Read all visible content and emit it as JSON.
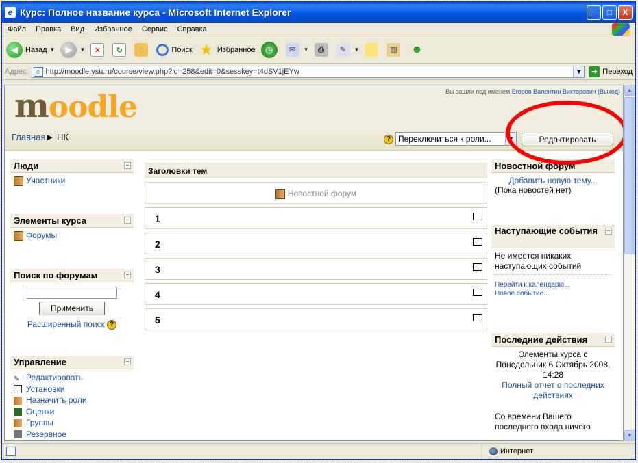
{
  "window": {
    "title": "Курс: Полное название курса - Microsoft Internet Explorer",
    "min": "_",
    "max": "□",
    "close": "X"
  },
  "menu": [
    "Файл",
    "Правка",
    "Вид",
    "Избранное",
    "Сервис",
    "Справка"
  ],
  "toolbar": {
    "back": "Назад",
    "search": "Поиск",
    "favorites": "Избранное"
  },
  "address": {
    "label": "Адрес:",
    "url": "http://moodle.ysu.ru/course/view.php?id=258&edit=0&sesskey=t4dSV1jEYw",
    "go": "Переход"
  },
  "status": {
    "zone": "Интернет"
  },
  "moodle": {
    "logo_m": "m",
    "logo_rest": "oodle",
    "login_text": "Вы зашли под именем",
    "login_user": "Егоров Валентин Викторович",
    "login_exit": "(Выход)",
    "breadcrumb_home": "Главная",
    "breadcrumb_sep": "►",
    "breadcrumb_course": "НК",
    "help": "?",
    "role_switch": "Переключиться к роли...",
    "edit_button": "Редактировать"
  },
  "left": {
    "people": {
      "title": "Люди",
      "items": [
        "Участники"
      ]
    },
    "activities": {
      "title": "Элементы курса",
      "items": [
        "Форумы"
      ]
    },
    "search": {
      "title": "Поиск по форумам",
      "input_value": "",
      "button": "Применить",
      "advanced": "Расширенный поиск"
    },
    "admin": {
      "title": "Управление",
      "items": [
        "Редактировать",
        "Установки",
        "Назначить роли",
        "Оценки",
        "Группы",
        "Резервное"
      ]
    }
  },
  "center": {
    "header": "Заголовки тем",
    "news": "Новостной форум",
    "topics": [
      "1",
      "2",
      "3",
      "4",
      "5"
    ]
  },
  "right": {
    "news": {
      "title": "Новостной форум",
      "add": "Добавить новую тему...",
      "none": "(Пока новостей нет)"
    },
    "events": {
      "title": "Наступающие события",
      "none": "Не имеется никаких наступающих событий",
      "calendar": "Перейти к календарю...",
      "new": "Новое событие..."
    },
    "recent": {
      "title": "Последние действия",
      "text": "Элементы курса с Понедельник 6 Октябрь 2008, 14:28",
      "full": "Полный отчет о последних действиях",
      "since": "Со времени Вашего последнего входа ничего"
    }
  },
  "colors": {
    "highlight": "#ff0000",
    "link": "#1a4fa0",
    "logo": "#f5a623"
  }
}
